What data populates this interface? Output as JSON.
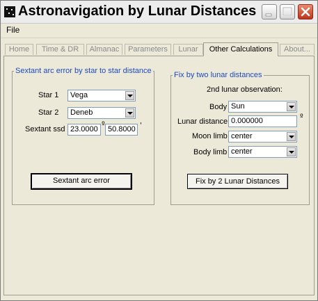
{
  "window": {
    "title": "Astronavigation by Lunar Distances"
  },
  "menu": {
    "file": "File"
  },
  "tabs": [
    "Home",
    "Time & DR",
    "Almanac",
    "Parameters",
    "Lunar",
    "Other Calculations",
    "About..."
  ],
  "sextant_group": {
    "legend": "Sextant arc error by star to star distance",
    "star1_label": "Star 1",
    "star1_value": "Vega",
    "star2_label": "Star 2",
    "star2_value": "Deneb",
    "ssd_label": "Sextant ssd",
    "ssd_degrees": "23.0000",
    "ssd_minutes": "50.8000",
    "degree_symbol": "º",
    "minute_symbol": "'",
    "button": "Sextant arc error"
  },
  "fix_group": {
    "legend": "Fix by two lunar distances",
    "subtitle": "2nd lunar observation:",
    "body_label": "Body",
    "body_value": "Sun",
    "lunar_distance_label": "Lunar distance",
    "lunar_distance_value": "0.000000",
    "degree_symbol": "º",
    "moon_limb_label": "Moon limb",
    "moon_limb_value": "center",
    "body_limb_label": "Body limb",
    "body_limb_value": "center",
    "button": "Fix by 2 Lunar Distances"
  }
}
